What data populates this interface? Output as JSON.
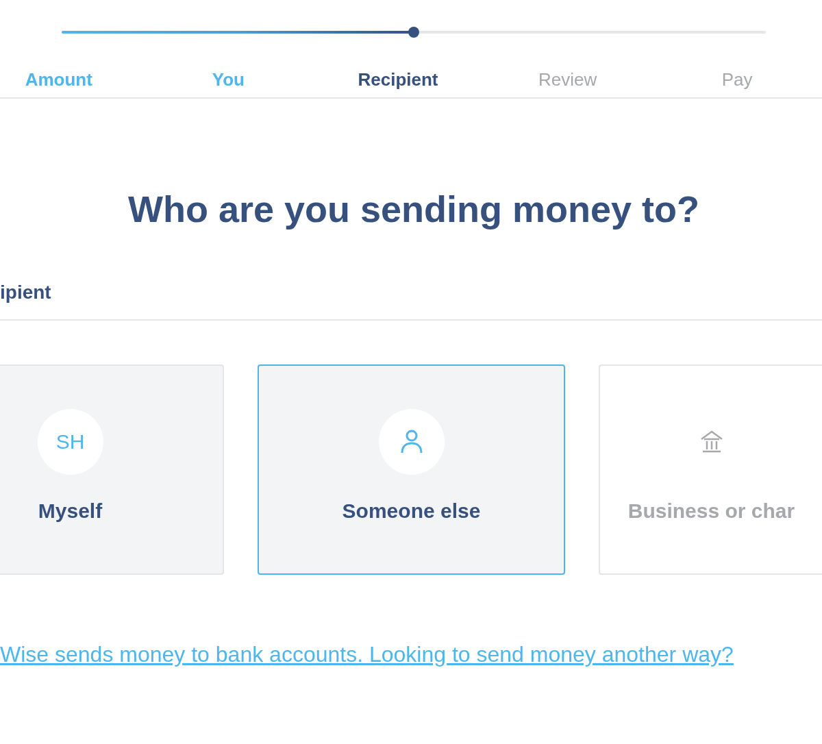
{
  "stepper": {
    "level": 0.5,
    "steps": [
      {
        "label": "Amount",
        "completed": true,
        "selected": false
      },
      {
        "label": "You",
        "completed": true,
        "selected": false
      },
      {
        "label": "Recipient",
        "completed": false,
        "selected": true
      },
      {
        "label": "Review",
        "completed": false,
        "selected": false
      },
      {
        "label": "Pay",
        "completed": false,
        "selected": false
      }
    ]
  },
  "heading": "Who are you sending money to?",
  "section_label": "ipient",
  "options": [
    {
      "label": "Myself",
      "kind": "initials",
      "initials": "SH",
      "selected": false,
      "disabled": false
    },
    {
      "label": "Someone else",
      "kind": "person",
      "selected": true,
      "disabled": false
    },
    {
      "label": "Business or char",
      "kind": "business",
      "selected": false,
      "disabled": true
    }
  ],
  "link": "Wise sends money to bank accounts. Looking to send money another way?"
}
